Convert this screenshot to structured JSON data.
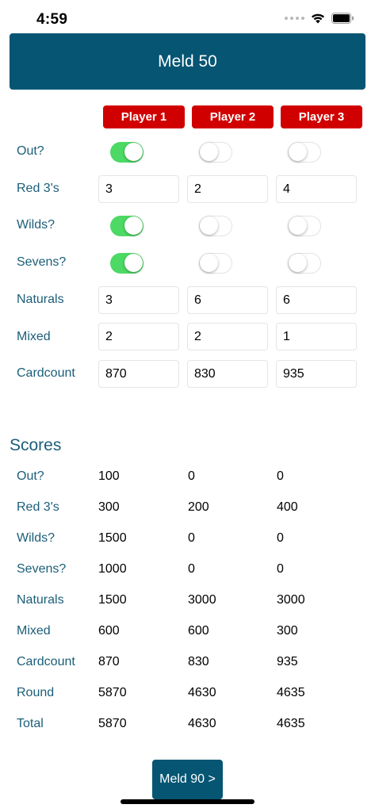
{
  "status_bar": {
    "time": "4:59"
  },
  "header": {
    "title": "Meld 50"
  },
  "players": [
    "Player 1",
    "Player 2",
    "Player 3"
  ],
  "input_labels": {
    "out": "Out?",
    "red3s": "Red 3's",
    "wilds": "Wilds?",
    "sevens": "Sevens?",
    "naturals": "Naturals",
    "mixed": "Mixed",
    "cardcount": "Cardcount"
  },
  "inputs": {
    "out": [
      true,
      false,
      false
    ],
    "red3s": [
      "3",
      "2",
      "4"
    ],
    "wilds": [
      true,
      false,
      false
    ],
    "sevens": [
      true,
      false,
      false
    ],
    "naturals": [
      "3",
      "6",
      "6"
    ],
    "mixed": [
      "2",
      "2",
      "1"
    ],
    "cardcount": [
      "870",
      "830",
      "935"
    ]
  },
  "scores": {
    "heading": "Scores",
    "rows": [
      {
        "label": "Out?",
        "values": [
          "100",
          "0",
          "0"
        ]
      },
      {
        "label": "Red 3's",
        "values": [
          "300",
          "200",
          "400"
        ]
      },
      {
        "label": "Wilds?",
        "values": [
          "1500",
          "0",
          "0"
        ]
      },
      {
        "label": "Sevens?",
        "values": [
          "1000",
          "0",
          "0"
        ]
      },
      {
        "label": "Naturals",
        "values": [
          "1500",
          "3000",
          "3000"
        ]
      },
      {
        "label": "Mixed",
        "values": [
          "600",
          "600",
          "300"
        ]
      },
      {
        "label": "Cardcount",
        "values": [
          "870",
          "830",
          "935"
        ]
      },
      {
        "label": "Round",
        "values": [
          "5870",
          "4630",
          "4635"
        ]
      },
      {
        "label": "Total",
        "values": [
          "5870",
          "4630",
          "4635"
        ]
      }
    ]
  },
  "footer": {
    "next_label": "Meld 90 >"
  },
  "colors": {
    "header_bg": "#065573",
    "player_btn_bg": "#d10000",
    "label_text": "#1b5e79",
    "toggle_on": "#4cd964"
  }
}
